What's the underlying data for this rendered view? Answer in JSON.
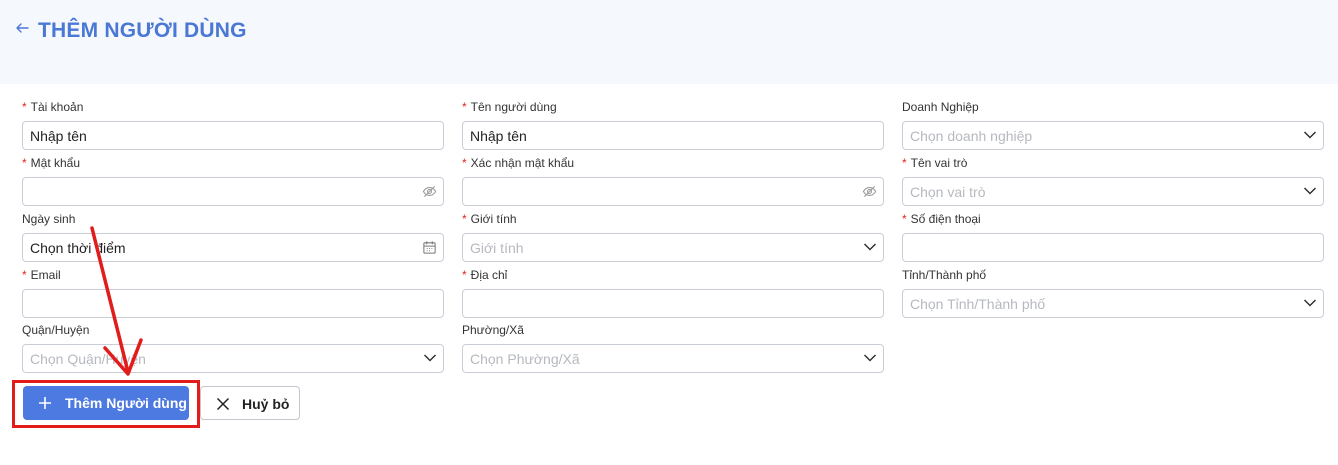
{
  "header": {
    "title": "THÊM NGƯỜI DÙNG"
  },
  "colors": {
    "accent": "#4a78d4",
    "primary_button": "#4d7ae0",
    "required": "#e0281f",
    "annotation": "#e21b1b"
  },
  "icons": {
    "back": "arrow-left-icon",
    "password": "eye-off-icon",
    "date": "calendar-icon",
    "select": "chevron-down-icon",
    "add": "plus-icon",
    "cancel": "close-icon"
  },
  "form": {
    "account": {
      "label": "Tài khoản",
      "required": "*",
      "value": "Nhập tên"
    },
    "username": {
      "label": "Tên người dùng",
      "required": "*",
      "value": "Nhập tên"
    },
    "company": {
      "label": "Doanh Nghiệp",
      "placeholder": "Chọn doanh nghiệp"
    },
    "password": {
      "label": "Mật khẩu",
      "required": "*",
      "value": ""
    },
    "confirm_password": {
      "label": "Xác nhận mật khẩu",
      "required": "*",
      "value": ""
    },
    "role": {
      "label": "Tên vai trò",
      "required": "*",
      "placeholder": "Chọn vai trò"
    },
    "birthday": {
      "label": "Ngày sinh",
      "value": "Chọn thời điểm"
    },
    "gender": {
      "label": "Giới tính",
      "required": "*",
      "placeholder": "Giới tính"
    },
    "phone": {
      "label": "Số điện thoại",
      "required": "*",
      "value": ""
    },
    "email": {
      "label": "Email",
      "required": "*",
      "value": ""
    },
    "address": {
      "label": "Địa chỉ",
      "required": "*",
      "value": ""
    },
    "province": {
      "label": "Tỉnh/Thành phố",
      "placeholder": "Chọn Tỉnh/Thành phố"
    },
    "district": {
      "label": "Quận/Huyện",
      "placeholder": "Chọn Quận/Huyện"
    },
    "ward": {
      "label": "Phường/Xã",
      "placeholder": "Chọn Phường/Xã"
    }
  },
  "actions": {
    "add_label": "Thêm Người dùng",
    "cancel_label": "Huỷ bỏ"
  }
}
